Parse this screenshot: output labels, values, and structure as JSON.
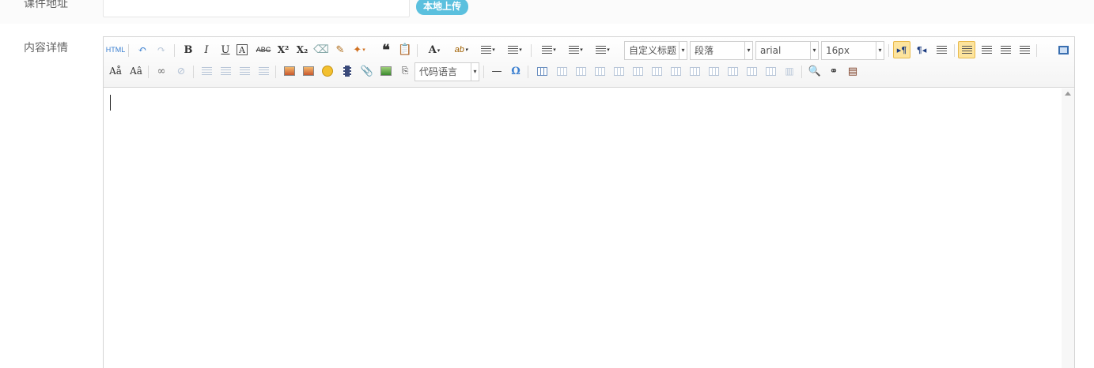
{
  "form": {
    "courseware_label": "课件地址",
    "upload_button": "本地上传",
    "content_label": "内容详情"
  },
  "toolbar": {
    "html_label": "HTML",
    "bold": "B",
    "italic": "I",
    "underline": "U",
    "fontborder": "A",
    "strikethrough": "ABC",
    "superscript": "X²",
    "subscript": "X₂",
    "blockquote": "❝",
    "forecolor": "A",
    "backcolor": "ab",
    "heading_combo": "自定义标题",
    "paragraph_combo": "段落",
    "font_family_combo": "arial",
    "font_size_combo": "16px",
    "ltr": "▸¶",
    "rtl": "¶◂",
    "code_language_combo": "代码语言",
    "horizontal_rule": "—",
    "special_char": "Ω"
  },
  "colors": {
    "upload_button_bg": "#5bc0de",
    "active_button_bg": "#fde49d",
    "icon_blue": "#3a7fd0",
    "icon_disabled": "#b8c6d8"
  }
}
